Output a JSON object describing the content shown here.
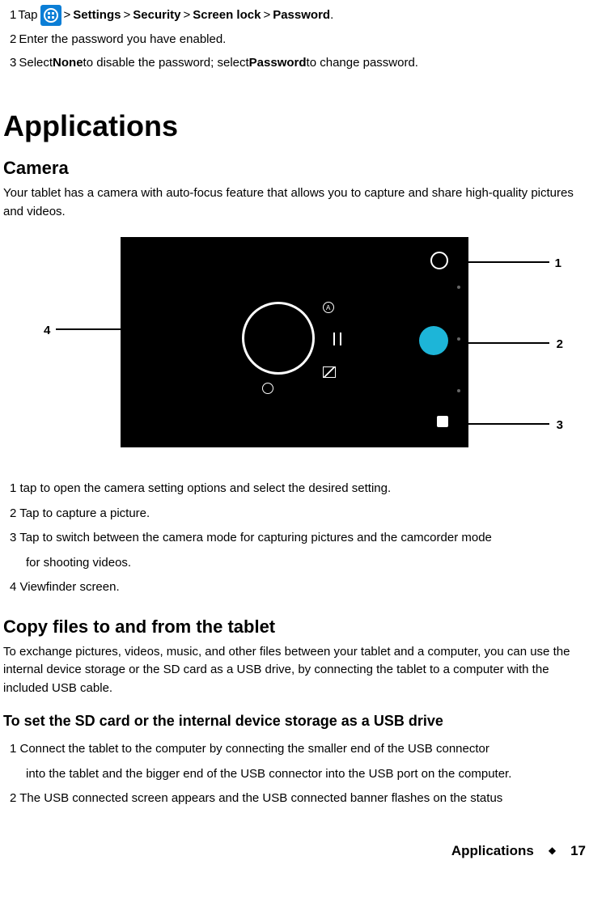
{
  "top_steps": {
    "s1_num": "1",
    "s1_a": "Tap",
    "s1_b": ">",
    "s1_settings": "Settings",
    "s1_c": ">",
    "s1_security": "Security",
    "s1_d": ">",
    "s1_screenlock": "Screen lock",
    "s1_e": ">",
    "s1_password": "Password",
    "s1_f": ".",
    "s2_num": "2",
    "s2_text": "Enter the password you have enabled.",
    "s3_num": "3",
    "s3_a": "Select ",
    "s3_none": "None",
    "s3_b": " to disable the password; select ",
    "s3_password": "Password",
    "s3_c": " to change password."
  },
  "h1": "Applications",
  "camera": {
    "title": "Camera",
    "intro": "Your tablet has a camera with auto-focus feature that allows you to capture and share high-quality pictures and videos."
  },
  "callouts": {
    "c1": "1",
    "c2": "2",
    "c3": "3",
    "c4": "4"
  },
  "camera_legend": {
    "i1": "1 tap to open the camera setting options and select the desired setting.",
    "i2": "2 Tap to capture a picture.",
    "i3": "3 Tap to switch between the camera mode for capturing pictures and the camcorder mode",
    "i3b": "for shooting videos.",
    "i4": "4 Viewfinder screen."
  },
  "copy": {
    "title": "Copy files to and from the tablet",
    "intro": "To exchange pictures, videos, music, and other files between your tablet and a computer, you can use the internal device storage or the SD card as a USB drive, by connecting the tablet to a computer with the included USB cable.",
    "subtitle": "To set the SD card or the internal device storage as a USB drive",
    "s1": "1 Connect the tablet to the computer by connecting the smaller end of the USB connector",
    "s1b": "into the tablet and the bigger end of the USB connector into the USB port on the computer.",
    "s2": "2 The USB connected screen appears and the USB connected banner flashes on the status"
  },
  "footer": {
    "title": "Applications",
    "page": "17"
  }
}
